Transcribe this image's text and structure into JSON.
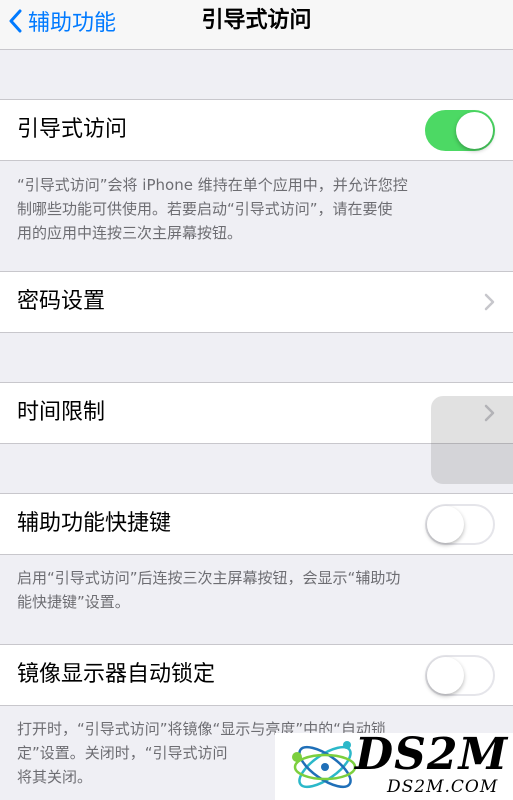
{
  "nav": {
    "back_label": "辅助功能",
    "title": "引导式访问"
  },
  "rows": {
    "guided_access": {
      "label": "引导式访问",
      "toggle": "on",
      "accent_color": "#4cd964"
    },
    "passcode": {
      "label": "密码设置"
    },
    "time_limits": {
      "label": "时间限制"
    },
    "shortcut": {
      "label": "辅助功能快捷键",
      "toggle": "off"
    },
    "mirror_lock": {
      "label": "镜像显示器自动锁定",
      "toggle": "off"
    }
  },
  "footers": {
    "guided_access": [
      "“引导式访问”会将 iPhone 维持在单个应用中，并允许您控",
      "制哪些功能可供使用。若要启动“引导式访问”，请在要使",
      "用的应用中连按三次主屏幕按钮。"
    ],
    "shortcut": [
      "启用“引导式访问”后连按三次主屏幕按钮，会显示“辅助功",
      "能快捷键”设置。"
    ],
    "mirror_lock": [
      "打开时，“引导式访问”将镜像“显示与亮度”中的“自动锁",
      "定”设置。关闭时，“引导式访问",
      "将其关闭。"
    ]
  },
  "watermark": {
    "logo_text": "DS2M",
    "url_text": "DS2M.COM"
  },
  "colors": {
    "link_blue": "#007aff",
    "background": "#efeff4"
  }
}
